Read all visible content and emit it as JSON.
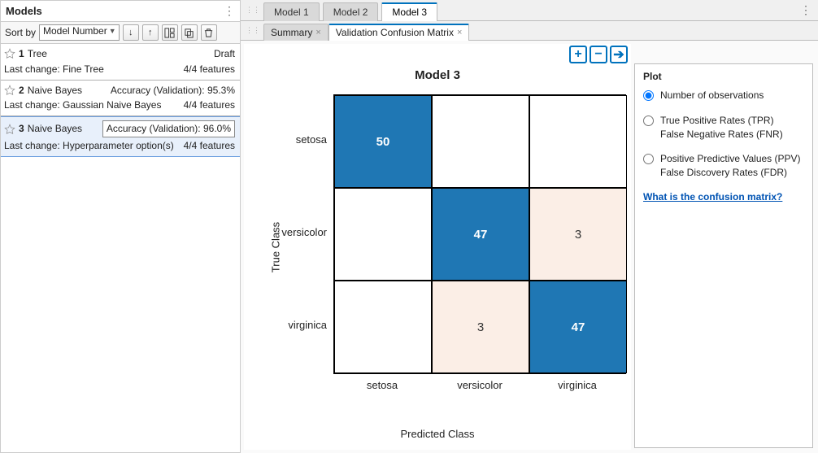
{
  "sidebar": {
    "title": "Models",
    "sort_label": "Sort by",
    "sort_value": "Model Number",
    "rows": [
      {
        "num": "1",
        "name": "Tree",
        "metric": "Draft",
        "change_label": "Last change: Fine Tree",
        "features": "4/4 features"
      },
      {
        "num": "2",
        "name": "Naive Bayes",
        "metric": "Accuracy (Validation): 95.3%",
        "change_label": "Last change: Gaussian Naive Bayes",
        "features": "4/4 features"
      },
      {
        "num": "3",
        "name": "Naive Bayes",
        "metric": "Accuracy (Validation): 96.0%",
        "change_label": "Last change: Hyperparameter option(s)",
        "features": "4/4 features"
      }
    ]
  },
  "main_tabs": [
    "Model 1",
    "Model 2",
    "Model 3"
  ],
  "sub_tabs": [
    "Summary",
    "Validation Confusion Matrix"
  ],
  "plot": {
    "title": "Model 3",
    "y_label": "True Class",
    "x_label": "Predicted Class",
    "ticks": [
      "setosa",
      "versicolor",
      "virginica"
    ]
  },
  "options": {
    "title": "Plot",
    "opt0": "Number of observations",
    "opt1a": "True Positive Rates (TPR)",
    "opt1b": "False Negative Rates (FNR)",
    "opt2a": "Positive Predictive Values (PPV)",
    "opt2b": "False Discovery Rates (FDR)",
    "help": "What is the confusion matrix?"
  },
  "chart_data": {
    "type": "heatmap",
    "title": "Model 3",
    "xlabel": "Predicted Class",
    "ylabel": "True Class",
    "categories": [
      "setosa",
      "versicolor",
      "virginica"
    ],
    "matrix": [
      [
        50,
        0,
        0
      ],
      [
        0,
        47,
        3
      ],
      [
        0,
        3,
        47
      ]
    ],
    "cell_labels": [
      [
        "50",
        "",
        ""
      ],
      [
        "",
        "47",
        "3"
      ],
      [
        "",
        "3",
        "47"
      ]
    ],
    "cell_colors": [
      [
        "blue",
        "white",
        "white"
      ],
      [
        "white",
        "blue",
        "pale"
      ],
      [
        "white",
        "pale",
        "blue"
      ]
    ]
  }
}
